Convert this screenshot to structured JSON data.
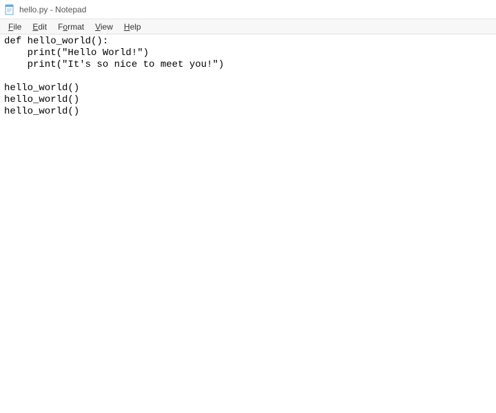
{
  "window": {
    "title": "hello.py - Notepad"
  },
  "menu": {
    "file": "File",
    "edit": "Edit",
    "format": "Format",
    "view": "View",
    "help": "Help"
  },
  "editor": {
    "content": "def hello_world():\n    print(\"Hello World!\")\n    print(\"It's so nice to meet you!\")\n\nhello_world()\nhello_world()\nhello_world()"
  }
}
